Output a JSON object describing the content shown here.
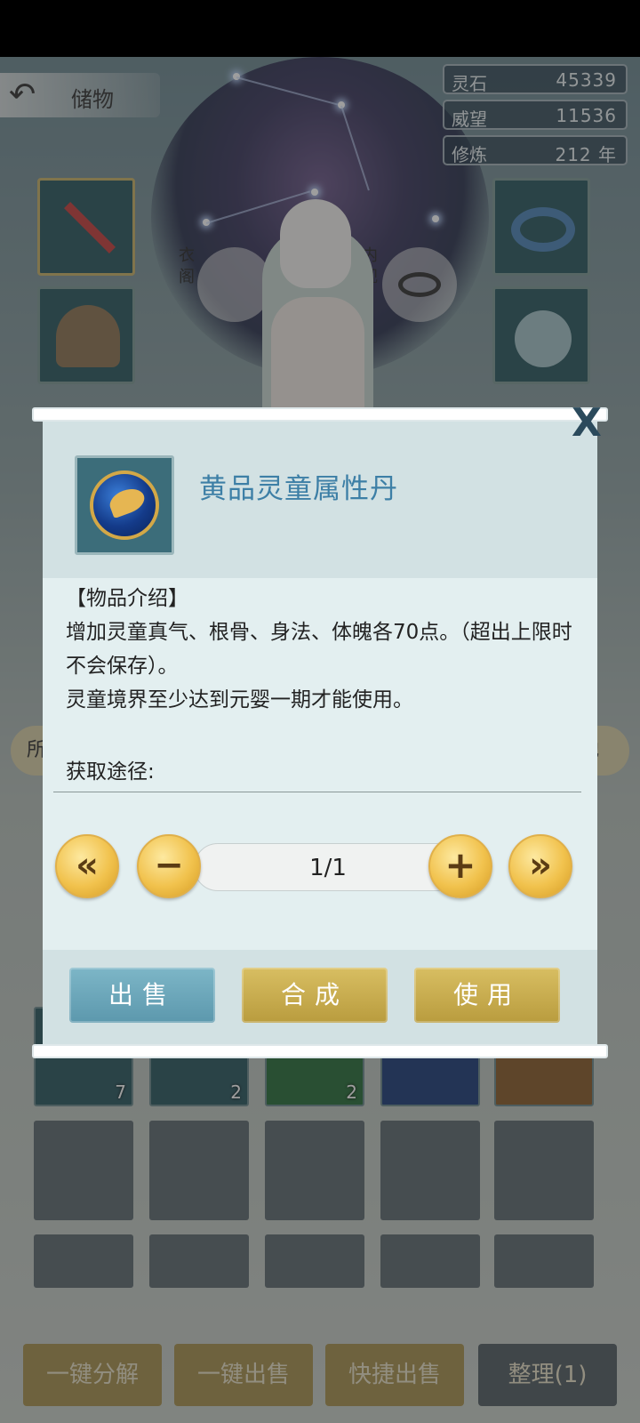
{
  "header": {
    "title": "储物"
  },
  "stats": [
    {
      "label": "灵石",
      "value": "45339"
    },
    {
      "label": "威望",
      "value": "11536"
    },
    {
      "label": "修炼",
      "value": "212 年"
    }
  ],
  "character": {
    "left_label": "衣阁",
    "right_label": "内视"
  },
  "side_tabs": {
    "left": "所",
    "right": "地"
  },
  "inventory_counts": [
    "7",
    "2",
    "2"
  ],
  "bottom_buttons": [
    "一键分解",
    "一键出售",
    "快捷出售",
    "整理(1)"
  ],
  "dialog": {
    "item_name": "黄品灵童属性丹",
    "close": "X",
    "intro_heading": "【物品介绍】",
    "intro_line1": "增加灵童真气、根骨、身法、体魄各70点。（超出上限时不会保存）。",
    "intro_line2": "灵童境界至少达到元婴一期才能使用。",
    "source_label": "获取途径:",
    "quantity": "1/1",
    "actions": {
      "sell": "出售",
      "combine": "合成",
      "use": "使用"
    }
  },
  "icons": {
    "back": "back-arrow-icon",
    "min": "double-left-icon",
    "minus": "minus-icon",
    "plus": "plus-icon",
    "max": "double-right-icon"
  }
}
